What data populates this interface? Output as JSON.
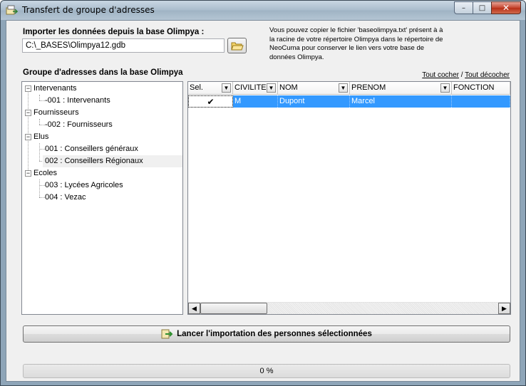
{
  "window": {
    "title": "Transfert de groupe d'adresses",
    "caption": {
      "minimize": "–",
      "maximize": "□",
      "close": "✕"
    }
  },
  "import": {
    "label": "Importer les données depuis la base Olimpya :",
    "path_value": "C:\\_BASES\\Olimpya12.gdb",
    "note": "Vous pouvez copier le fichier 'baseolimpya.txt' présent à à la racine de votre répertoire Olimpya dans le répertoire de NeoCuma pour conserver le lien vers votre base de données Olimpya."
  },
  "groups": {
    "label": "Groupe d'adresses dans la base Olimpya",
    "check_all": "Tout cocher",
    "separator": "/",
    "uncheck_all": "Tout décocher",
    "tree": [
      {
        "label": "Intervenants",
        "expander": "−"
      },
      {
        "label": "-001 : Intervenants"
      },
      {
        "label": "Fournisseurs",
        "expander": "−"
      },
      {
        "label": "-002 : Fournisseurs"
      },
      {
        "label": "Elus",
        "expander": "−"
      },
      {
        "label": "001 : Conseillers généraux"
      },
      {
        "label": "002 : Conseillers Régionaux",
        "selected": true
      },
      {
        "label": "Ecoles",
        "expander": "−"
      },
      {
        "label": "003 : Lycées Agricoles"
      },
      {
        "label": "004 : Vezac"
      }
    ]
  },
  "table": {
    "columns": [
      "Sel.",
      "CIVILITE",
      "NOM",
      "PRENOM",
      "FONCTION"
    ],
    "dropdown_glyph": "▼",
    "rows": [
      {
        "checked": true,
        "civilite": "M",
        "nom": "Dupont",
        "prenom": "Marcel",
        "fonction": ""
      }
    ],
    "check_glyph": "✔",
    "scroll_left": "◀",
    "scroll_right": "▶"
  },
  "actions": {
    "import_button": "Lancer l'importation des personnes sélectionnées"
  },
  "progress": {
    "text": "0 %",
    "value": 0
  },
  "colors": {
    "selection": "#3399ff",
    "titlebar": "#a9bccc"
  }
}
